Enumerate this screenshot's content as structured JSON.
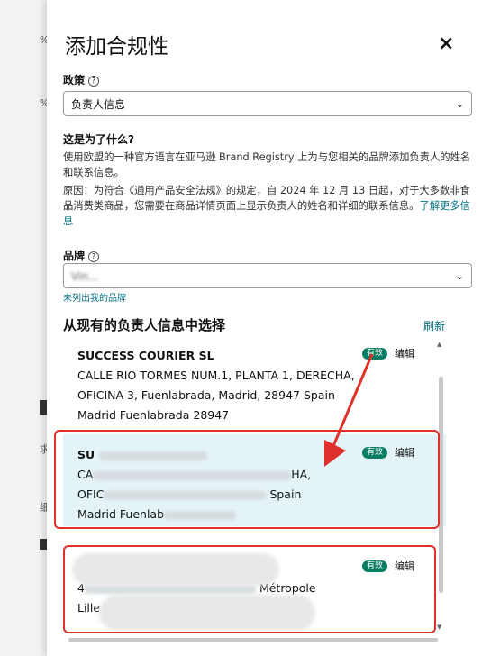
{
  "modal": {
    "title": "添加合规性",
    "close_glyph": "×"
  },
  "policy": {
    "label": "政策",
    "help_glyph": "?",
    "selected": "负责人信息",
    "chevron_glyph": "⌄"
  },
  "explanation": {
    "heading": "这是为了什么?",
    "p1": "使用欧盟的一种官方语言在亚马逊 Brand Registry 上为与您相关的品牌添加负责人的姓名和联系信息。",
    "p2": "原因：为符合《通用产品安全法规》的规定，自 2024 年 12 月 13 日起，对于大多数非食品消费类商品，您需要在商品详情页面上显示负责人的姓名和详细的联系信息。",
    "learn_more": "了解更多信息"
  },
  "brand": {
    "label": "品牌",
    "help_glyph": "?",
    "selected": "Vin...",
    "not_listed_link": "未列出我的品牌"
  },
  "existing": {
    "title": "从现有的负责人信息中选择",
    "refresh": "刷新",
    "badge_label": "有效",
    "edit_label": "编辑",
    "cards": [
      {
        "name": "SUCCESS COURIER SL",
        "line1": "CALLE RIO TORMES NUM.1, PLANTA 1, DERECHA,",
        "line2": "OFICINA 3, Fuenlabrada, Madrid, 28947 Spain",
        "line3": "Madrid Fuenlabrada 28947"
      },
      {
        "name": "SU",
        "line1a": "CA",
        "line1b": "HA,",
        "line2a": "OFIC",
        "line2b": "Spain",
        "line3": "Madrid Fuenlab"
      },
      {
        "line1a": "4",
        "line1b": "Métropole",
        "line2": "Lille I"
      }
    ]
  },
  "background_fragments": {
    "f1": "%",
    "f2": "%",
    "f3": "求",
    "f4": "细"
  },
  "colors": {
    "accent_link": "#007185",
    "badge_green": "#067d62",
    "selected_bg": "#e4f3f7",
    "highlight_red": "#e0302b"
  }
}
